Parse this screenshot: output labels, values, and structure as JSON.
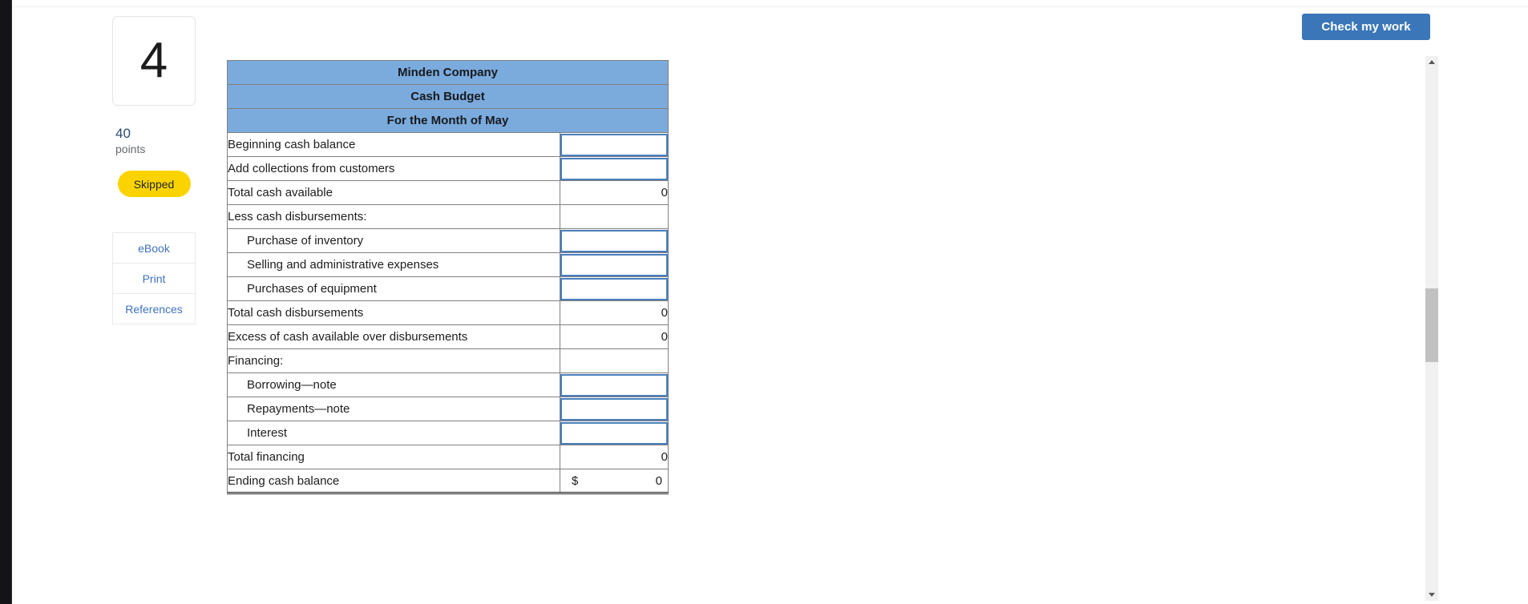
{
  "toolbar": {
    "check_work_label": "Check my work"
  },
  "sidebar": {
    "question_number": "4",
    "points_value": "40",
    "points_label": "points",
    "status_badge": "Skipped",
    "links": [
      {
        "label": "eBook"
      },
      {
        "label": "Print"
      },
      {
        "label": "References"
      }
    ]
  },
  "budget": {
    "titles": [
      "Minden Company",
      "Cash Budget",
      "For the Month of May"
    ],
    "rows": [
      {
        "label": "Beginning cash balance",
        "indent": false,
        "type": "input",
        "value": "",
        "currency": ""
      },
      {
        "label": "Add collections from customers",
        "indent": false,
        "type": "input",
        "value": "",
        "currency": ""
      },
      {
        "label": "Total cash available",
        "indent": false,
        "type": "static",
        "value": "0",
        "currency": ""
      },
      {
        "label": "Less cash disbursements:",
        "indent": false,
        "type": "blank",
        "value": "",
        "currency": ""
      },
      {
        "label": "Purchase of inventory",
        "indent": true,
        "type": "input",
        "value": "",
        "currency": ""
      },
      {
        "label": "Selling and administrative expenses",
        "indent": true,
        "type": "input",
        "value": "",
        "currency": ""
      },
      {
        "label": "Purchases of equipment",
        "indent": true,
        "type": "input",
        "value": "",
        "currency": ""
      },
      {
        "label": "Total cash disbursements",
        "indent": false,
        "type": "static",
        "value": "0",
        "currency": ""
      },
      {
        "label": "Excess of cash available over disbursements",
        "indent": false,
        "type": "static",
        "value": "0",
        "currency": ""
      },
      {
        "label": "Financing:",
        "indent": false,
        "type": "blank",
        "value": "",
        "currency": ""
      },
      {
        "label": "Borrowing—note",
        "indent": true,
        "type": "input",
        "value": "",
        "currency": ""
      },
      {
        "label": "Repayments—note",
        "indent": true,
        "type": "input",
        "value": "",
        "currency": ""
      },
      {
        "label": "Interest",
        "indent": true,
        "type": "input",
        "value": "",
        "currency": ""
      },
      {
        "label": "Total financing",
        "indent": false,
        "type": "static",
        "value": "0",
        "currency": ""
      },
      {
        "label": "Ending cash balance",
        "indent": false,
        "type": "total",
        "value": "0",
        "currency": "$"
      }
    ],
    "input_placeholder": ""
  },
  "scrollbar": {
    "up_arrow": "scroll-up",
    "down_arrow": "scroll-down"
  },
  "colors": {
    "header_blue": "#7babdd",
    "accent_blue": "#3a76b8",
    "input_border": "#4a7fbe",
    "badge_yellow": "#fbd400",
    "link_blue": "#3f72bd"
  }
}
